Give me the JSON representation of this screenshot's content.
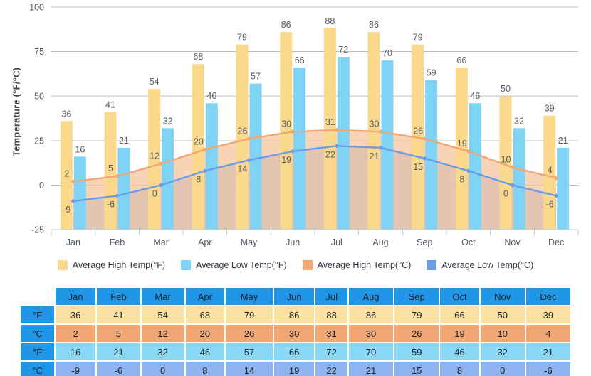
{
  "chart_data": {
    "type": "bar",
    "title": "",
    "xlabel": "",
    "ylabel": "Temperature (°F/°C)",
    "ylim": [
      -25,
      100
    ],
    "yticks": [
      -25,
      0,
      25,
      50,
      75,
      100
    ],
    "ytick_labels": [
      "-25",
      "0",
      "25",
      "50",
      "75",
      "100"
    ],
    "grid": true,
    "legend_position": "bottom",
    "categories": [
      "Jan",
      "Feb",
      "Mar",
      "Apr",
      "May",
      "Jun",
      "Jul",
      "Aug",
      "Sep",
      "Oct",
      "Nov",
      "Dec"
    ],
    "series": [
      {
        "name": "Average High Temp(°F)",
        "type": "bar",
        "color": "#fad88c",
        "values": [
          36,
          41,
          54,
          68,
          79,
          86,
          88,
          86,
          79,
          66,
          50,
          39
        ]
      },
      {
        "name": "Average Low Temp(°F)",
        "type": "bar",
        "color": "#7fd3f5",
        "values": [
          16,
          21,
          32,
          46,
          57,
          66,
          72,
          70,
          59,
          46,
          32,
          21
        ]
      },
      {
        "name": "Average High Temp(°C)",
        "type": "area",
        "color": "#f0a773",
        "values": [
          2,
          5,
          12,
          20,
          26,
          30,
          31,
          30,
          26,
          19,
          10,
          4
        ]
      },
      {
        "name": "Average Low Temp(°C)",
        "type": "area",
        "color": "#6c9be8",
        "values": [
          -9,
          -6,
          0,
          8,
          14,
          19,
          22,
          21,
          15,
          8,
          0,
          -6
        ]
      }
    ]
  },
  "legend": {
    "items": [
      {
        "label": "Average High Temp(°F)",
        "color": "#fad88c"
      },
      {
        "label": "Average Low Temp(°F)",
        "color": "#7fd3f5"
      },
      {
        "label": "Average High Temp(°C)",
        "color": "#f0a773"
      },
      {
        "label": "Average Low Temp(°C)",
        "color": "#6c9be8"
      }
    ]
  },
  "table": {
    "corner_label": "",
    "columns": [
      "Jan",
      "Feb",
      "Mar",
      "Apr",
      "May",
      "Jun",
      "Jul",
      "Aug",
      "Sep",
      "Oct",
      "Nov",
      "Dec"
    ],
    "rows": [
      {
        "unit": "°F",
        "style": "cell-high-f",
        "values": [
          "36",
          "41",
          "54",
          "68",
          "79",
          "86",
          "88",
          "86",
          "79",
          "66",
          "50",
          "39"
        ]
      },
      {
        "unit": "°C",
        "style": "cell-high-c",
        "values": [
          "2",
          "5",
          "12",
          "20",
          "26",
          "30",
          "31",
          "30",
          "26",
          "19",
          "10",
          "4"
        ]
      },
      {
        "unit": "°F",
        "style": "cell-low-f",
        "values": [
          "16",
          "21",
          "32",
          "46",
          "57",
          "66",
          "72",
          "70",
          "59",
          "46",
          "32",
          "21"
        ]
      },
      {
        "unit": "°C",
        "style": "cell-low-c",
        "values": [
          "-9",
          "-6",
          "0",
          "8",
          "14",
          "19",
          "22",
          "21",
          "15",
          "8",
          "0",
          "-6"
        ]
      }
    ]
  },
  "colors": {
    "bar_high_f": "#fad88c",
    "bar_low_f": "#7fd3f5",
    "line_high_c": "#f0a773",
    "line_low_c": "#6c9be8",
    "area_high_c_fill": "#f5c49b",
    "area_low_c_fill": "#aabee8",
    "grid": "#b8bcc0",
    "axis": "#b9cfdd",
    "table_header": "#2196e8",
    "label_text": "#555c63"
  }
}
